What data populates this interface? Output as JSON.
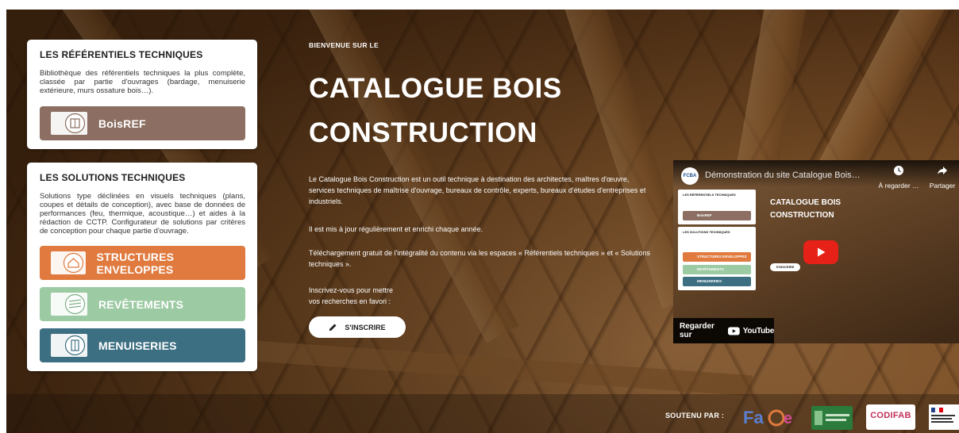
{
  "left": {
    "ref_card": {
      "title": "LES RÉFÉRENTIELS TECHNIQUES",
      "desc": "Bibliothèque des référentiels techniques la plus complète, classée par partie d'ouvrages (bardage, menuiserie extérieure, murs ossature bois…).",
      "button": {
        "label": "BoisREF",
        "color": "#8c6f62",
        "icon": "book-icon"
      }
    },
    "sol_card": {
      "title": "LES SOLUTIONS TECHNIQUES",
      "desc": "Solutions type déclinées en visuels techniques (plans, coupes et détails de conception), avec base de données de performances (feu, thermique, acoustique…) et aides à la rédaction de CCTP. Configurateur de solutions par critères de conception pour chaque partie d'ouvrage.",
      "buttons": [
        {
          "label": "STRUCTURES ENVELOPPES",
          "color": "#e07a3e",
          "icon": "house-icon"
        },
        {
          "label": "REVÊTEMENTS",
          "color": "#9ccaa3",
          "icon": "cladding-icon"
        },
        {
          "label": "MENUISERIES",
          "color": "#3d6f82",
          "icon": "window-icon"
        }
      ]
    }
  },
  "hero": {
    "welcome": "BIENVENUE SUR LE",
    "title_line1": "CATALOGUE BOIS",
    "title_line2": "CONSTRUCTION",
    "para1": "Le Catalogue Bois Construction est un outil technique à destination des architectes, maîtres d'œuvre, services techniques de maîtrise d'ouvrage, bureaux de contrôle, experts, bureaux d'études d'entreprises et industriels.",
    "para2": "Il est mis à jour régulièrement et enrichi chaque année.",
    "para3": "Téléchargement gratuit de l'intégralité du contenu via les espaces « Référentiels techniques » et « Solutions techniques ».",
    "para4_line1": "Inscrivez-vous pour mettre",
    "para4_line2": "vos recherches en favori :",
    "signup_label": "S'INSCRIRE"
  },
  "video": {
    "channel_badge": "FCBA",
    "title": "Démonstration du site Catalogue Bois…",
    "watch_later": "À regarder …",
    "share": "Partager",
    "watch_on": "Regarder sur",
    "youtube": "YouTube",
    "thumb": {
      "title_line1": "CATALOGUE BOIS",
      "title_line2": "CONSTRUCTION",
      "ref_title": "LES RÉFÉRENTIELS TECHNIQUES",
      "sol_title": "LES SOLUTIONS TECHNIQUES",
      "btn_ref": "BoisREF",
      "btn_struct": "STRUCTURES ENVELOPPES",
      "btn_rev": "REVÊTEMENTS",
      "btn_men": "MENUISERIES",
      "btn_signup": "S'INSCRIRE"
    }
  },
  "footer": {
    "soutenu": "SOUTENU PAR :",
    "codifab": "CODIFAB"
  }
}
